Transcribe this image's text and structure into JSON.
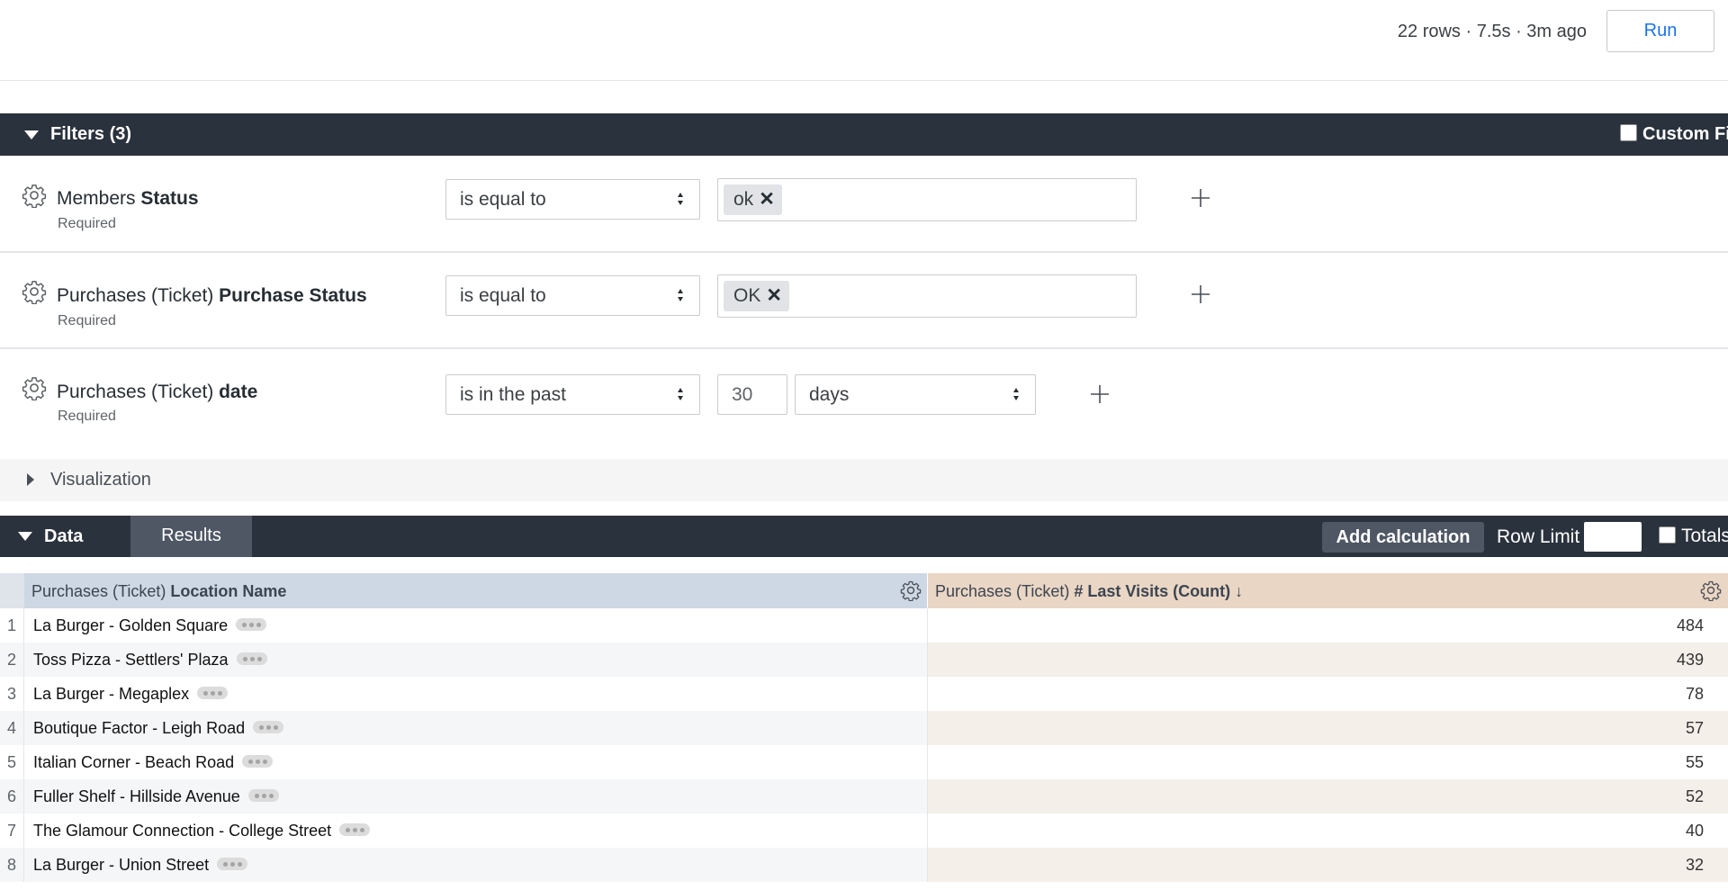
{
  "header": {
    "run_info": "22 rows · 7.5s · 3m ago",
    "run_label": "Run"
  },
  "filters": {
    "title": "Filters (3)",
    "custom_filter_label": "Custom Fi",
    "rows": [
      {
        "view": "Members",
        "field": "Status",
        "required": "Required",
        "operator": "is equal to",
        "value": "ok"
      },
      {
        "view": "Purchases (Ticket)",
        "field": "Purchase Status",
        "required": "Required",
        "operator": "is equal to",
        "value": "OK"
      },
      {
        "view": "Purchases (Ticket)",
        "field": "date",
        "required": "Required",
        "operator": "is in the past",
        "number": "30",
        "unit": "days"
      }
    ]
  },
  "visualization": {
    "title": "Visualization"
  },
  "data_bar": {
    "title": "Data",
    "results_tab": "Results",
    "add_calculation": "Add calculation",
    "row_limit_label": "Row Limit",
    "row_limit_value": "",
    "totals_label": "Totals"
  },
  "table": {
    "columns": [
      {
        "view": "Purchases (Ticket)",
        "field": "Location Name",
        "sort": ""
      },
      {
        "view": "Purchases (Ticket)",
        "field": "# Last Visits (Count)",
        "sort": "↓"
      }
    ],
    "rows": [
      {
        "num": "1",
        "name": "La Burger - Golden Square",
        "count": "484"
      },
      {
        "num": "2",
        "name": "Toss Pizza - Settlers' Plaza",
        "count": "439"
      },
      {
        "num": "3",
        "name": "La Burger - Megaplex",
        "count": "78"
      },
      {
        "num": "4",
        "name": "Boutique Factor - Leigh Road",
        "count": "57"
      },
      {
        "num": "5",
        "name": "Italian Corner - Beach Road",
        "count": "55"
      },
      {
        "num": "6",
        "name": "Fuller Shelf - Hillside Avenue",
        "count": "52"
      },
      {
        "num": "7",
        "name": "The Glamour Connection - College Street",
        "count": "40"
      },
      {
        "num": "8",
        "name": "La Burger - Union Street",
        "count": "32"
      }
    ]
  },
  "colors": {
    "dark_bar": "#2a323d",
    "dimension_header": "#cdd8e4",
    "measure_header": "#ead6c4",
    "run_text": "#1a73e8"
  },
  "icons": [
    "gear-icon",
    "plus-icon",
    "caret-down-icon",
    "caret-right-icon",
    "select-arrows-icon",
    "remove-x-icon",
    "row-actions-icon"
  ]
}
